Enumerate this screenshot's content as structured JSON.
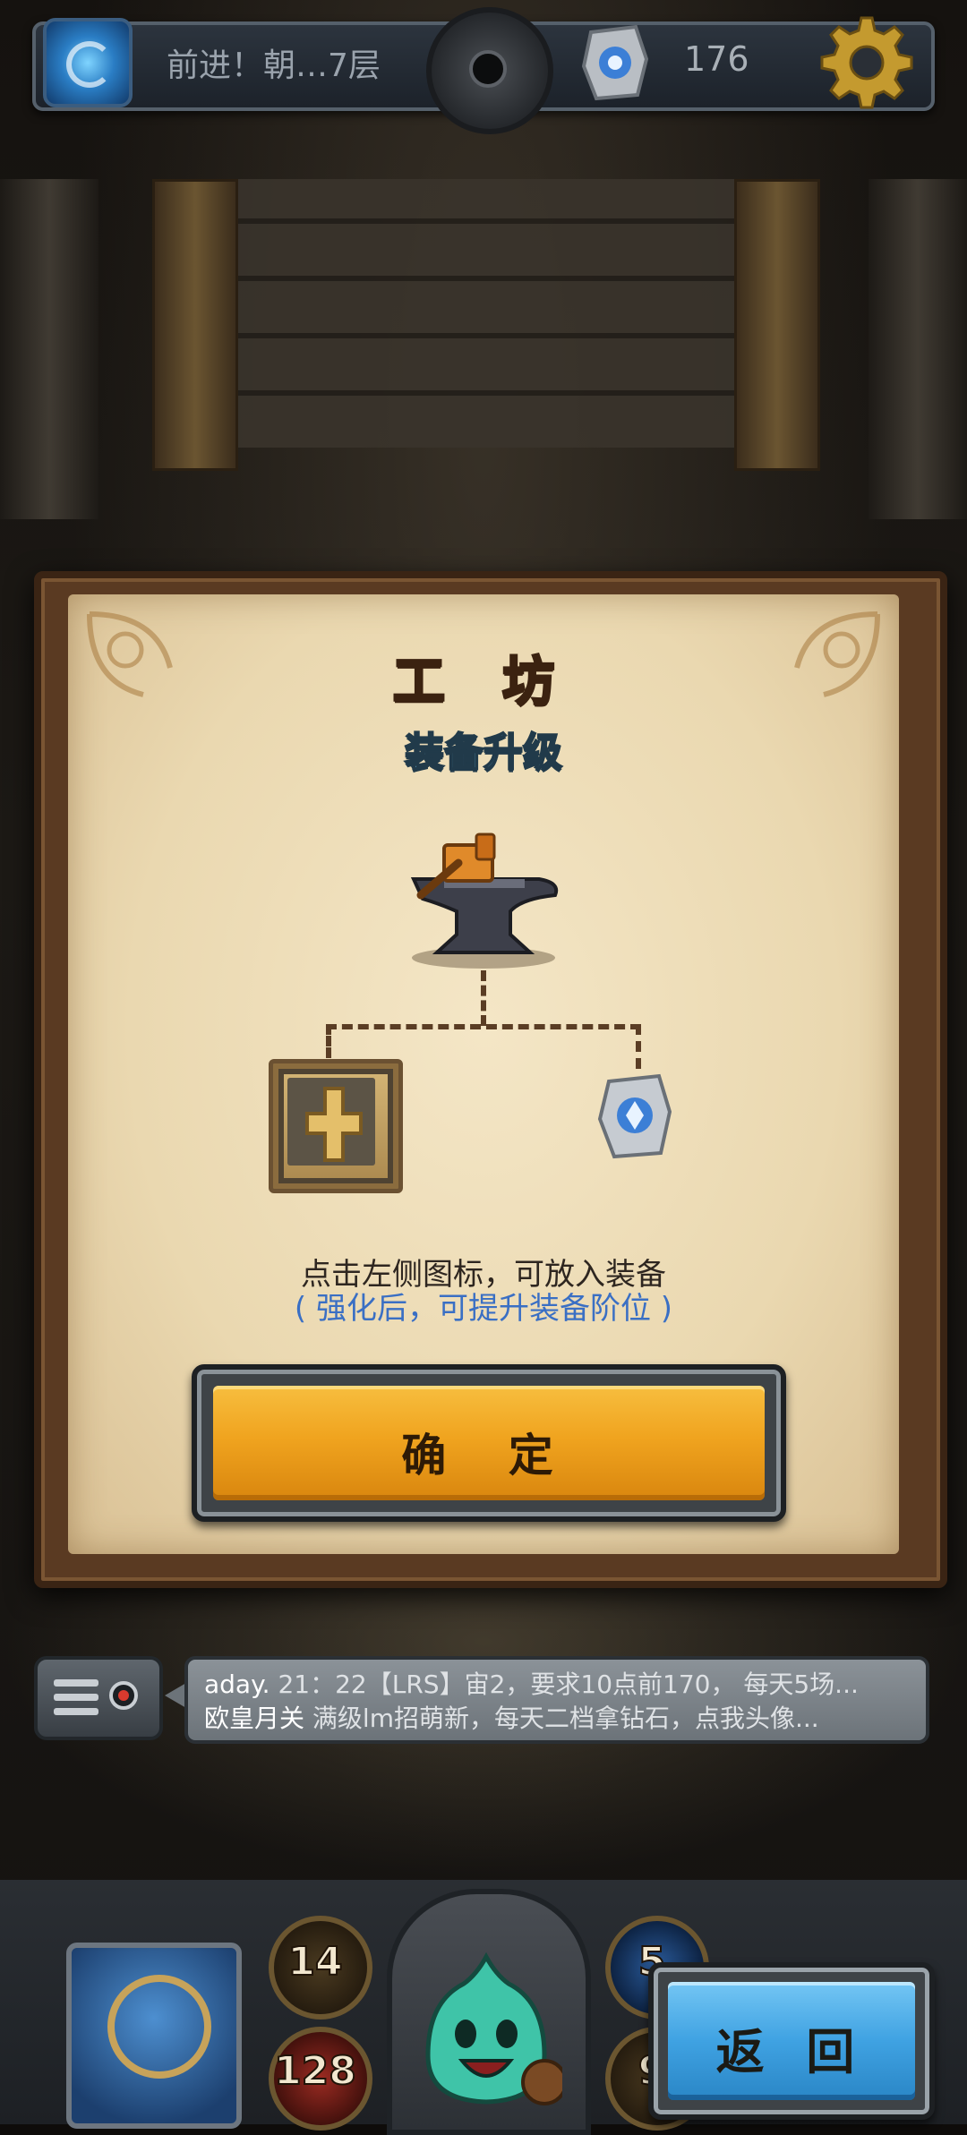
{
  "hud": {
    "floor_text": "前进！朝…7层",
    "rune_count": "176"
  },
  "dialog": {
    "title": "工 坊",
    "subtitle": "装备升级",
    "hint_line1": "点击左侧图标，可放入装备",
    "hint_line2": "( 强化后，可提升装备阶位 )",
    "confirm_label": "确 定"
  },
  "chat": {
    "line1_name": "aday.",
    "line1_msg": " 21：22【LRS】宙2，要求10点前170， 每天5场...",
    "line2_name": "欧皇月关",
    "line2_msg": " 满级lm招萌新，每天二档拿钻石，点我头像..."
  },
  "stats": {
    "top_left": "14",
    "bottom_left": "128",
    "top_right": "5",
    "bottom_right": "9"
  },
  "back_label": "返 回",
  "colors": {
    "title": "#d97c2a",
    "subtitle": "#6fc6e8",
    "hint_blue": "#3a6fc4",
    "confirm_button": "#f0a41f",
    "back_button": "#3fa2e2"
  }
}
